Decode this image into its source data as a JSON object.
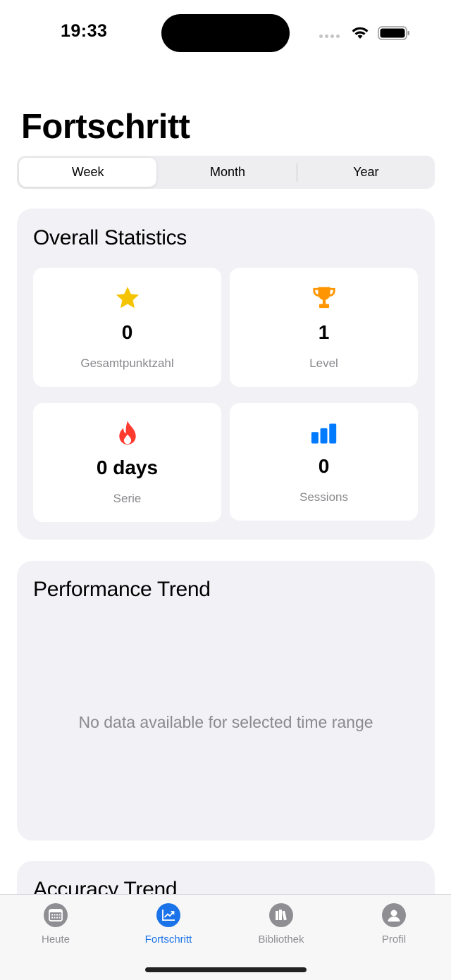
{
  "status_bar": {
    "time": "19:33"
  },
  "page": {
    "title": "Fortschritt"
  },
  "range_selector": {
    "options": [
      "Week",
      "Month",
      "Year"
    ],
    "selected": "Week"
  },
  "overall_statistics": {
    "title": "Overall Statistics",
    "tiles": [
      {
        "icon": "star-icon",
        "value": "0",
        "label": "Gesamtpunktzahl",
        "color": "#f5c400"
      },
      {
        "icon": "trophy-icon",
        "value": "1",
        "label": "Level",
        "color": "#ff9500"
      },
      {
        "icon": "flame-icon",
        "value": "0 days",
        "label": "Serie",
        "color": "#ff3b30"
      },
      {
        "icon": "bar-chart-icon",
        "value": "0",
        "label": "Sessions",
        "color": "#007aff"
      }
    ]
  },
  "performance_trend": {
    "title": "Performance Trend",
    "empty_message": "No data available for selected time range"
  },
  "accuracy_trend": {
    "title": "Accuracy Trend"
  },
  "tab_bar": {
    "tabs": [
      {
        "label": "Heute",
        "icon": "calendar-icon",
        "active": false
      },
      {
        "label": "Fortschritt",
        "icon": "chart-line-icon",
        "active": true
      },
      {
        "label": "Bibliothek",
        "icon": "books-icon",
        "active": false
      },
      {
        "label": "Profil",
        "icon": "person-icon",
        "active": false
      }
    ],
    "accent_color": "#1a73e8"
  }
}
